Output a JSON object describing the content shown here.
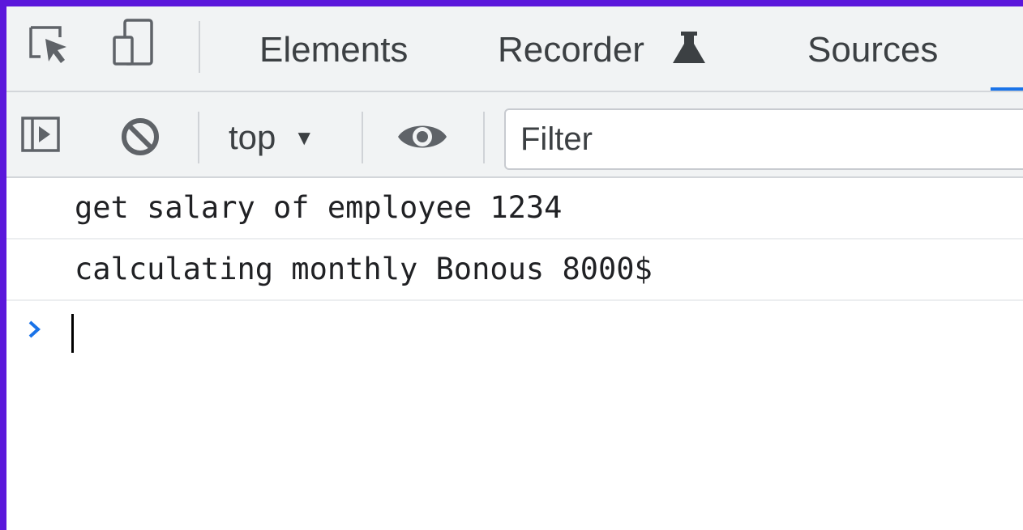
{
  "colors": {
    "frame_border": "#5b17db",
    "toolbar_bg": "#f1f3f4",
    "accent": "#1a73e8",
    "text": "#3c4043"
  },
  "tabbar": {
    "icons": [
      "inspect-element-icon",
      "device-toggle-icon"
    ],
    "tabs": [
      {
        "label": "Elements"
      },
      {
        "label": "Recorder",
        "icon": "flask-icon"
      },
      {
        "label": "Sources",
        "active": true
      }
    ]
  },
  "toolbar": {
    "icons": [
      "sidebar-toggle-icon",
      "clear-console-icon",
      "eye-icon"
    ],
    "context": {
      "value": "top",
      "caret": "▼"
    },
    "filter": {
      "placeholder": "Filter",
      "value": ""
    }
  },
  "console": {
    "messages": [
      {
        "text": "get salary of employee 1234"
      },
      {
        "text": "calculating monthly Bonous 8000$"
      }
    ],
    "prompt": {
      "symbol": "chevron-right-icon",
      "value": ""
    }
  }
}
